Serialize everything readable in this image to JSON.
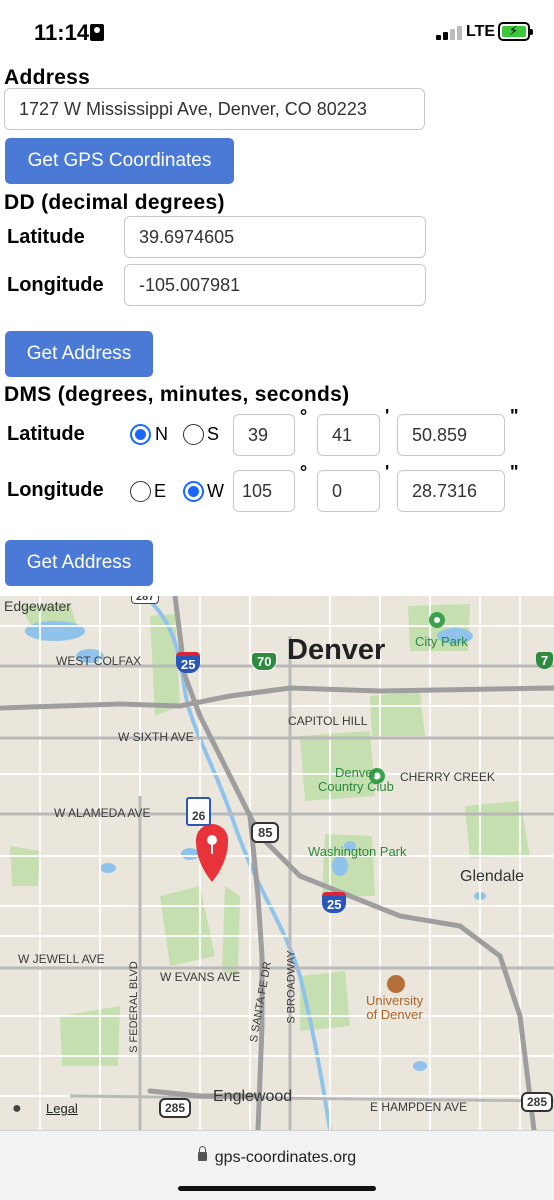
{
  "status": {
    "time": "11:14",
    "network": "LTE"
  },
  "address": {
    "heading": "Address",
    "value": "1727 W Mississippi Ave, Denver, CO  80223",
    "button": "Get GPS Coordinates"
  },
  "dd": {
    "heading": "DD (decimal degrees)",
    "lat_label": "Latitude",
    "lat_value": "39.6974605",
    "lon_label": "Longitude",
    "lon_value": "-105.007981",
    "button": "Get Address"
  },
  "dms": {
    "heading": "DMS (degrees, minutes, seconds)",
    "lat_label": "Latitude",
    "lat_n": "N",
    "lat_s": "S",
    "lat_selected": "N",
    "lat_deg": "39",
    "lat_min": "41",
    "lat_sec": "50.859",
    "lon_label": "Longitude",
    "lon_e": "E",
    "lon_w": "W",
    "lon_selected": "W",
    "lon_deg": "105",
    "lon_min": "0",
    "lon_sec": "28.7316",
    "deg_symbol": "°",
    "min_symbol": "'",
    "sec_symbol": "\"",
    "button": "Get Address"
  },
  "map": {
    "city": "Denver",
    "labels": {
      "edgewater": "Edgewater",
      "west_colfax": "WEST COLFAX",
      "capitol_hill": "CAPITOL HILL",
      "city_park": "City Park",
      "sixth_ave": "W SIXTH AVE",
      "denver_cc": "Denver\nCountry Club",
      "cherry_creek": "CHERRY CREEK",
      "alameda": "W ALAMEDA AVE",
      "washington_park": "Washington Park",
      "glendale": "Glendale",
      "jewell": "W JEWELL AVE",
      "evans": "W EVANS AVE",
      "federal": "S FEDERAL BLVD",
      "santa_fe": "S SANTA FE DR",
      "broadway": "S BROADWAY",
      "university": "University\nof Denver",
      "englewood": "Englewood",
      "hampden": "E HAMPDEN AVE",
      "legal": "Legal"
    },
    "shields": {
      "i25a": "25",
      "i70": "70",
      "i25b": "25",
      "us85": "85",
      "us285a": "285",
      "us285b": "285",
      "co26": "26",
      "us287": "287",
      "i70b": "7"
    }
  },
  "browser": {
    "url": "gps-coordinates.org"
  }
}
